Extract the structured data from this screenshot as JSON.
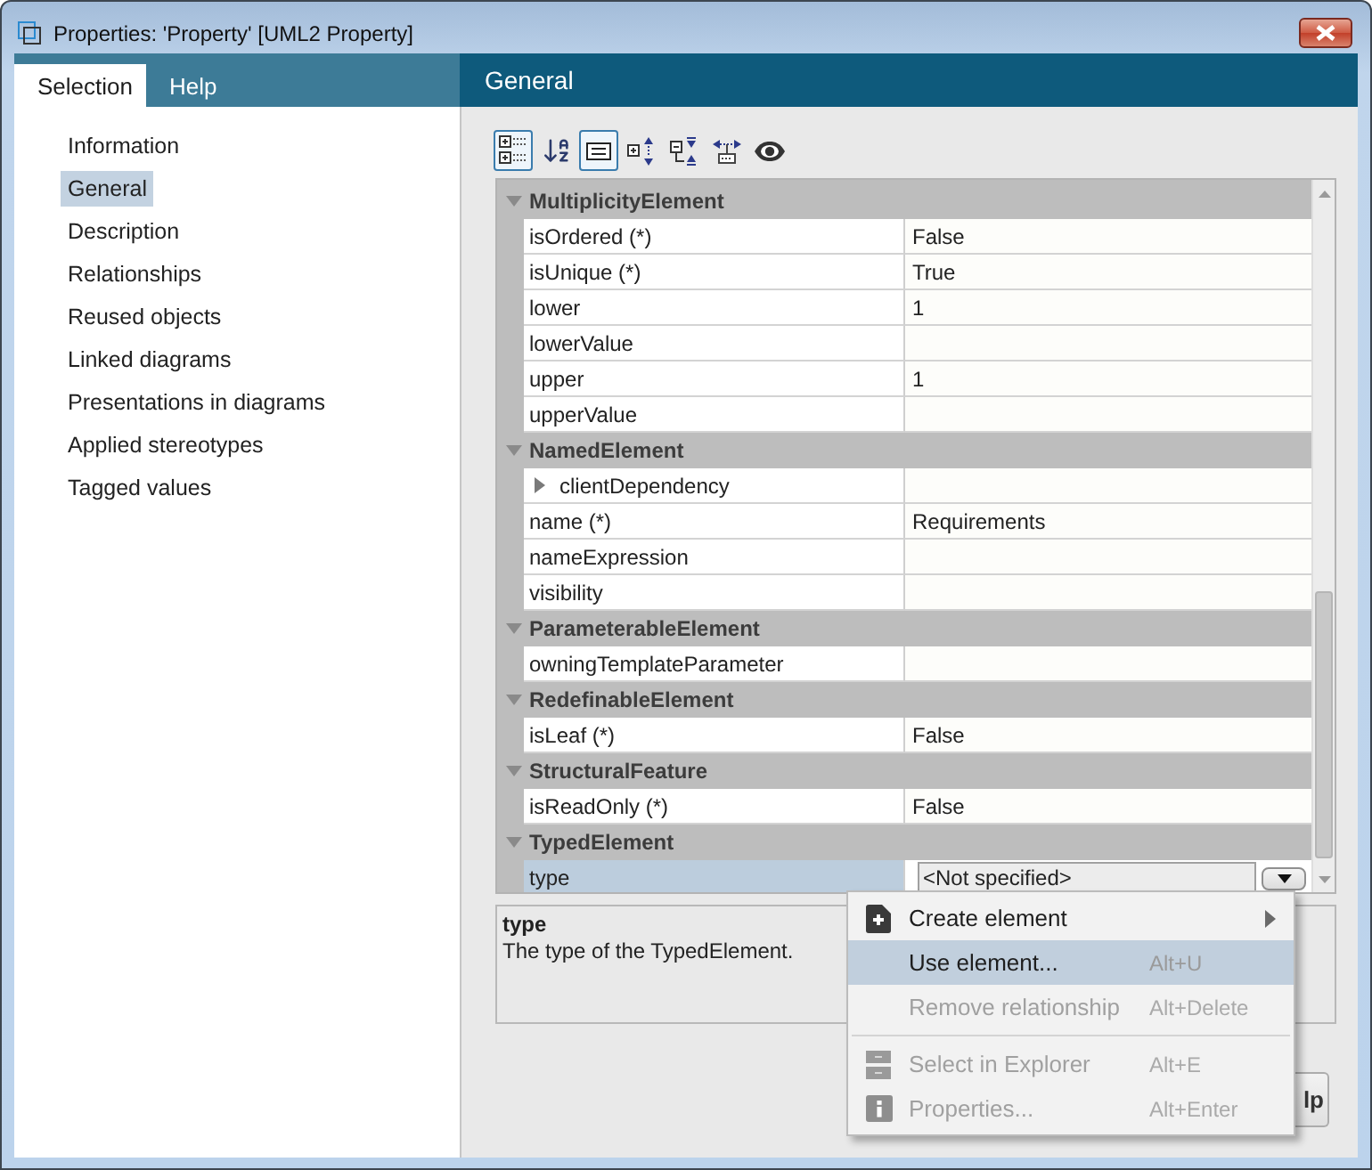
{
  "window": {
    "title": "Properties: 'Property' [UML2 Property]"
  },
  "tabs": [
    {
      "label": "Selection",
      "selected": true
    },
    {
      "label": "Help",
      "selected": false
    }
  ],
  "panel": {
    "title": "General"
  },
  "sidebar": {
    "items": [
      {
        "label": "Information",
        "selected": false
      },
      {
        "label": "General",
        "selected": true
      },
      {
        "label": "Description",
        "selected": false
      },
      {
        "label": "Relationships",
        "selected": false
      },
      {
        "label": "Reused objects",
        "selected": false
      },
      {
        "label": "Linked diagrams",
        "selected": false
      },
      {
        "label": "Presentations in diagrams",
        "selected": false
      },
      {
        "label": "Applied stereotypes",
        "selected": false
      },
      {
        "label": "Tagged values",
        "selected": false
      }
    ]
  },
  "toolbar": [
    {
      "pressed": true
    },
    {
      "pressed": false
    },
    {
      "pressed": true
    },
    {
      "pressed": false
    },
    {
      "pressed": false
    },
    {
      "pressed": false
    },
    {
      "pressed": false
    }
  ],
  "property_grid": {
    "groups": [
      {
        "name": "MultiplicityElement",
        "expanded": true,
        "rows": [
          {
            "kind": "field",
            "name": "isOrdered (*)",
            "value": "False",
            "selected": false
          },
          {
            "kind": "field",
            "name": "isUnique (*)",
            "value": "True",
            "selected": false
          },
          {
            "kind": "field",
            "name": "lower",
            "value": "1",
            "selected": false
          },
          {
            "kind": "field",
            "name": "lowerValue",
            "selected": false
          },
          {
            "kind": "field",
            "name": "upper",
            "value": "1",
            "selected": false
          },
          {
            "kind": "field",
            "name": "upperValue",
            "selected": false
          }
        ]
      },
      {
        "name": "NamedElement",
        "expanded": true,
        "rows": [
          {
            "kind": "tree",
            "name": "clientDependency",
            "expanded": false,
            "selected": false
          },
          {
            "kind": "field",
            "name": "name (*)",
            "value": "Requirements",
            "selected": false
          },
          {
            "kind": "field",
            "name": "nameExpression",
            "selected": false
          },
          {
            "kind": "field",
            "name": "visibility",
            "selected": false
          }
        ]
      },
      {
        "name": "ParameterableElement",
        "expanded": true,
        "rows": [
          {
            "kind": "field",
            "name": "owningTemplateParameter",
            "selected": false
          }
        ]
      },
      {
        "name": "RedefinableElement",
        "expanded": true,
        "rows": [
          {
            "kind": "field",
            "name": "isLeaf (*)",
            "value": "False",
            "selected": false
          }
        ]
      },
      {
        "name": "StructuralFeature",
        "expanded": true,
        "rows": [
          {
            "kind": "field",
            "name": "isReadOnly (*)",
            "value": "False",
            "selected": false
          }
        ]
      },
      {
        "name": "TypedElement",
        "expanded": true,
        "rows": [
          {
            "kind": "dropdown",
            "name": "type",
            "value": "<Not specified>",
            "selected": true
          }
        ]
      }
    ]
  },
  "description": {
    "title": "type",
    "text": "The type of the TypedElement."
  },
  "help_button": {
    "label": "lp"
  },
  "context_menu": {
    "sections": [
      [
        {
          "label": "Create element",
          "submenu": true,
          "disabled": false,
          "selected": false
        },
        {
          "label": "Use element...",
          "shortcut": "Alt+U",
          "submenu": false,
          "disabled": false,
          "selected": true
        },
        {
          "label": "Remove relationship",
          "shortcut": "Alt+Delete",
          "submenu": false,
          "disabled": true,
          "selected": false
        }
      ],
      [
        {
          "label": "Select in Explorer",
          "shortcut": "Alt+E",
          "submenu": false,
          "disabled": true,
          "selected": false
        },
        {
          "label": "Properties...",
          "shortcut": "Alt+Enter",
          "submenu": false,
          "disabled": true,
          "selected": false
        }
      ]
    ]
  }
}
